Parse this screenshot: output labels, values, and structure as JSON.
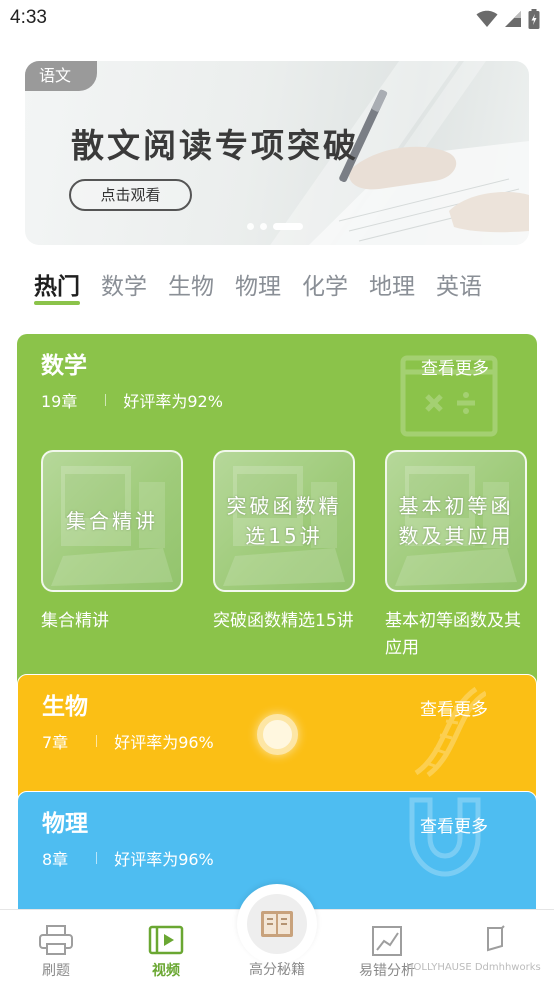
{
  "status_bar": {
    "time": "4:33"
  },
  "banner": {
    "tag": "语文",
    "title": "散文阅读专项突破",
    "button_label": "点击观看",
    "dots_count": 3,
    "active_dot": 2
  },
  "tabs": [
    {
      "label": "热门",
      "active": true
    },
    {
      "label": "数学",
      "active": false
    },
    {
      "label": "生物",
      "active": false
    },
    {
      "label": "物理",
      "active": false
    },
    {
      "label": "化学",
      "active": false
    },
    {
      "label": "地理",
      "active": false
    },
    {
      "label": "英语",
      "active": false
    }
  ],
  "cards": {
    "math": {
      "title": "数学",
      "more": "查看更多",
      "chapters": "19章",
      "rating": "好评率为92%",
      "icon": "calculator-board-icon",
      "courses": [
        {
          "thumb_text": "集合精讲",
          "caption": "集合精讲"
        },
        {
          "thumb_text": "突破函数精选15讲",
          "caption": "突破函数精选15讲"
        },
        {
          "thumb_text": "基本初等函数及其应用",
          "caption": "基本初等函数及其应用"
        }
      ]
    },
    "biology": {
      "title": "生物",
      "more": "查看更多",
      "chapters": "7章",
      "rating": "好评率为96%",
      "icon": "dna-icon"
    },
    "physics": {
      "title": "物理",
      "more": "查看更多",
      "chapters": "8章",
      "rating": "好评率为96%",
      "icon": "magnet-icon"
    }
  },
  "bottom_nav": {
    "items": [
      {
        "label": "刷题",
        "icon": "printer-icon",
        "active": false
      },
      {
        "label": "视频",
        "icon": "video-icon",
        "active": true
      },
      {
        "label": "高分秘籍",
        "icon": "book-icon",
        "active": false
      },
      {
        "label": "易错分析",
        "icon": "chart-icon",
        "active": false
      },
      {
        "label": "",
        "icon": "page-icon",
        "active": false
      }
    ]
  },
  "watermark": "HOLLYHAUSE Ddmhhworks",
  "colors": {
    "math": "#8bc34a",
    "biology": "#fbbf15",
    "physics": "#4ebdf1",
    "accent": "#6aa732"
  }
}
